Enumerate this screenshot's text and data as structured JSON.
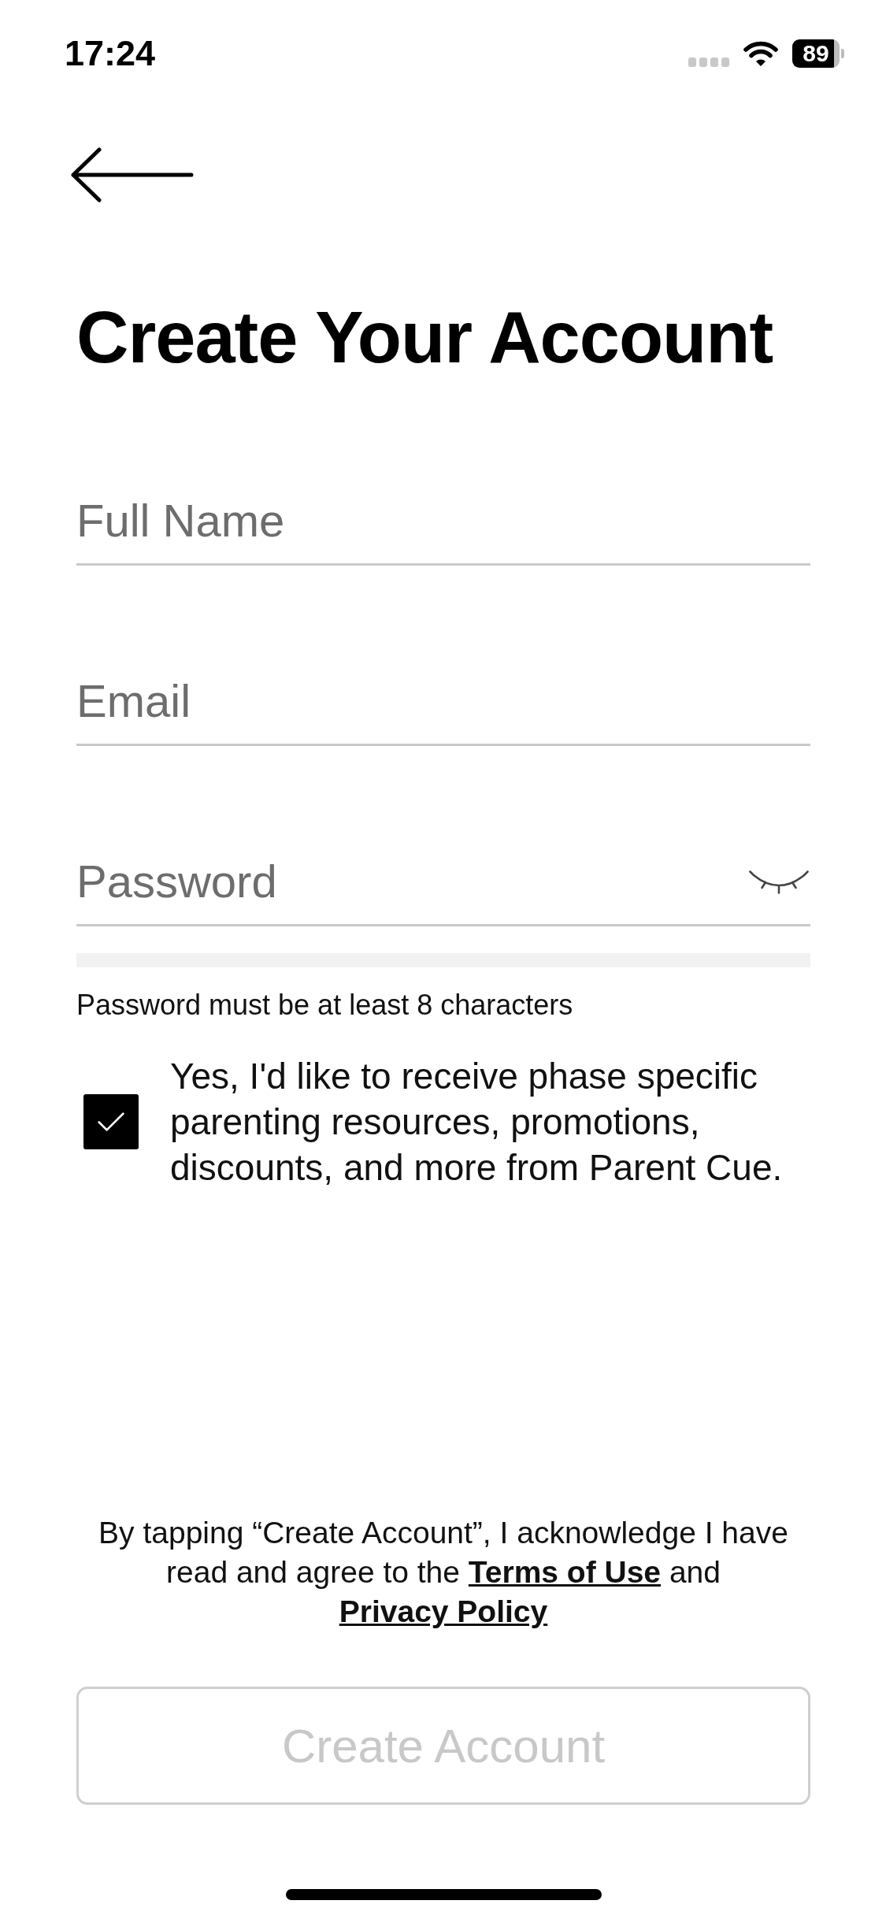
{
  "status_bar": {
    "time": "17:24",
    "battery": "89"
  },
  "title": "Create Your Account",
  "fields": [
    {
      "kind": "text",
      "placeholder": "Full Name"
    },
    {
      "kind": "email",
      "placeholder": "Email"
    },
    {
      "kind": "password",
      "placeholder": "Password",
      "masked": true
    }
  ],
  "password_strength": {
    "level": 0
  },
  "hint": "Password must be at least 8 characters",
  "consent": {
    "checked": true,
    "label": "Yes, I'd like to receive phase specific parenting resources, promotions, discounts, and more from Parent Cue."
  },
  "legal": [
    {
      "kind": "text",
      "text": "By tapping “Create Account”, I acknowledge I have read and agree to the"
    },
    {
      "kind": "link",
      "text": "Terms of Use"
    },
    {
      "kind": "text",
      "text": "and"
    },
    {
      "kind": "link",
      "text": "Privacy Policy"
    }
  ],
  "button": {
    "label": "Create Account",
    "disabled": true
  }
}
